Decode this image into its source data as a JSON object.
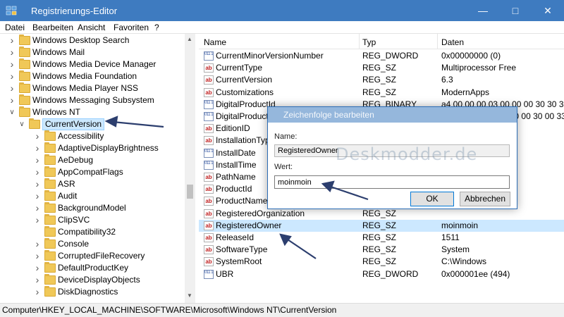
{
  "window": {
    "title": "Registrierungs-Editor",
    "minimize_icon": "minimize-icon",
    "maximize_icon": "maximize-icon",
    "close_icon": "close-icon"
  },
  "menu": [
    "Datei",
    "Bearbeiten",
    "Ansicht",
    "Favoriten",
    "?"
  ],
  "tree": {
    "items": [
      {
        "label": "Windows Desktop Search",
        "level": 1,
        "expander": "right"
      },
      {
        "label": "Windows Mail",
        "level": 1,
        "expander": "right"
      },
      {
        "label": "Windows Media Device Manager",
        "level": 1,
        "expander": "right"
      },
      {
        "label": "Windows Media Foundation",
        "level": 1,
        "expander": "right"
      },
      {
        "label": "Windows Media Player NSS",
        "level": 1,
        "expander": "right"
      },
      {
        "label": "Windows Messaging Subsystem",
        "level": 1,
        "expander": "right"
      },
      {
        "label": "Windows NT",
        "level": 1,
        "expander": "down"
      },
      {
        "label": "CurrentVersion",
        "level": 2,
        "expander": "down",
        "selected": true
      },
      {
        "label": "Accessibility",
        "level": 3,
        "expander": "right"
      },
      {
        "label": "AdaptiveDisplayBrightness",
        "level": 3,
        "expander": "right"
      },
      {
        "label": "AeDebug",
        "level": 3,
        "expander": "right"
      },
      {
        "label": "AppCompatFlags",
        "level": 3,
        "expander": "right"
      },
      {
        "label": "ASR",
        "level": 3,
        "expander": "right"
      },
      {
        "label": "Audit",
        "level": 3,
        "expander": "right"
      },
      {
        "label": "BackgroundModel",
        "level": 3,
        "expander": "right"
      },
      {
        "label": "ClipSVC",
        "level": 3,
        "expander": "right"
      },
      {
        "label": "Compatibility32",
        "level": 3,
        "expander": "none"
      },
      {
        "label": "Console",
        "level": 3,
        "expander": "right"
      },
      {
        "label": "CorruptedFileRecovery",
        "level": 3,
        "expander": "right"
      },
      {
        "label": "DefaultProductKey",
        "level": 3,
        "expander": "right"
      },
      {
        "label": "DeviceDisplayObjects",
        "level": 3,
        "expander": "right"
      },
      {
        "label": "DiskDiagnostics",
        "level": 3,
        "expander": "right"
      }
    ]
  },
  "list": {
    "headers": {
      "name": "Name",
      "type": "Typ",
      "data": "Daten"
    },
    "rows": [
      {
        "icon": "bin",
        "name": "CurrentMinorVersionNumber",
        "type": "REG_DWORD",
        "data": "0x00000000 (0)"
      },
      {
        "icon": "ab",
        "name": "CurrentType",
        "type": "REG_SZ",
        "data": "Multiprocessor Free"
      },
      {
        "icon": "ab",
        "name": "CurrentVersion",
        "type": "REG_SZ",
        "data": "6.3"
      },
      {
        "icon": "ab",
        "name": "Customizations",
        "type": "REG_SZ",
        "data": "ModernApps"
      },
      {
        "icon": "bin",
        "name": "DigitalProductId",
        "type": "REG_BINARY",
        "data": "a4 00 00 00 03 00 00 00 30 30 33"
      },
      {
        "icon": "bin",
        "name": "DigitalProductId4",
        "type": "REG_BINARY",
        "data": "f8 04 00 00 04 00 00 00 30 00 33 0"
      },
      {
        "icon": "ab",
        "name": "EditionID",
        "type": "",
        "data": ""
      },
      {
        "icon": "ab",
        "name": "InstallationType",
        "type": "",
        "data": ""
      },
      {
        "icon": "bin",
        "name": "InstallDate",
        "type": "",
        "data": "87)"
      },
      {
        "icon": "bin",
        "name": "InstallTime",
        "type": "",
        "data": "1309321388"
      },
      {
        "icon": "ab",
        "name": "PathName",
        "type": "",
        "data": ""
      },
      {
        "icon": "ab",
        "name": "ProductId",
        "type": "",
        "data": "A677"
      },
      {
        "icon": "ab",
        "name": "ProductName",
        "type": "",
        "data": ""
      },
      {
        "icon": "ab",
        "name": "RegisteredOrganization",
        "type": "REG_SZ",
        "data": ""
      },
      {
        "icon": "ab",
        "name": "RegisteredOwner",
        "type": "REG_SZ",
        "data": "moinmoin",
        "selected": true
      },
      {
        "icon": "ab",
        "name": "ReleaseId",
        "type": "REG_SZ",
        "data": "1511"
      },
      {
        "icon": "ab",
        "name": "SoftwareType",
        "type": "REG_SZ",
        "data": "System"
      },
      {
        "icon": "ab",
        "name": "SystemRoot",
        "type": "REG_SZ",
        "data": "C:\\Windows"
      },
      {
        "icon": "bin",
        "name": "UBR",
        "type": "REG_DWORD",
        "data": "0x000001ee (494)"
      }
    ]
  },
  "dialog": {
    "title": "Zeichenfolge bearbeiten",
    "name_label": "Name:",
    "name_value": "RegisteredOwner",
    "value_label": "Wert:",
    "value_value": "moinmoin",
    "ok_label": "OK",
    "cancel_label": "Abbrechen",
    "watermark": "Deskmodder.de"
  },
  "status": {
    "path": "Computer\\HKEY_LOCAL_MACHINE\\SOFTWARE\\Microsoft\\Windows NT\\CurrentVersion"
  },
  "colors": {
    "titlebar": "#3e7bc0",
    "selection": "#cce8ff",
    "annotation_arrow": "#2c3e6e"
  }
}
